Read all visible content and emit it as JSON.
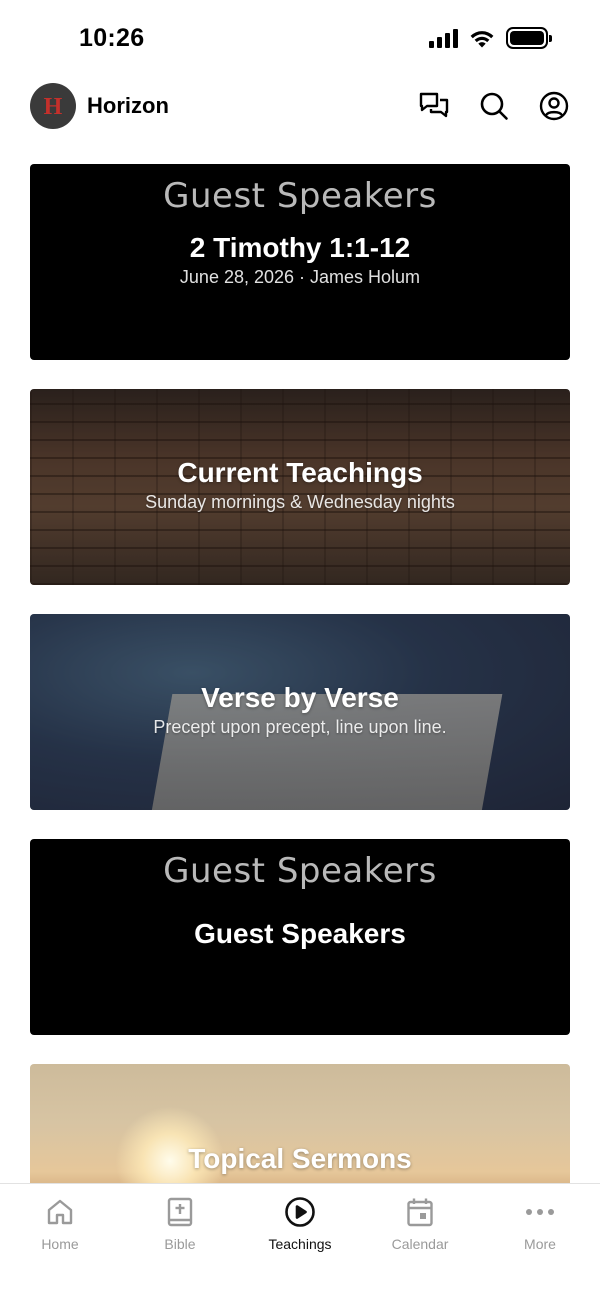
{
  "status_bar": {
    "time": "10:26"
  },
  "header": {
    "app_name": "Horizon",
    "logo_letter": "H",
    "icons": [
      "chat-icon",
      "search-icon",
      "account-icon"
    ]
  },
  "cards": [
    {
      "banner": "Guest Speakers",
      "title": "2 Timothy 1:1-12",
      "subtitle": "June 28, 2026 · James Holum"
    },
    {
      "title": "Current Teachings",
      "subtitle": "Sunday mornings & Wednesday nights"
    },
    {
      "title": "Verse by Verse",
      "subtitle": "Precept upon precept, line upon line."
    },
    {
      "banner": "Guest Speakers",
      "title": "Guest Speakers"
    },
    {
      "title": "Topical Sermons"
    }
  ],
  "tab_bar": {
    "active": "Teachings",
    "tabs": [
      {
        "label": "Home",
        "icon": "home-icon"
      },
      {
        "label": "Bible",
        "icon": "bible-icon"
      },
      {
        "label": "Teachings",
        "icon": "play-circle-icon"
      },
      {
        "label": "Calendar",
        "icon": "calendar-icon"
      },
      {
        "label": "More",
        "icon": "more-icon"
      }
    ]
  },
  "colors": {
    "logo_accent": "#c4302b",
    "tab_inactive": "#9a9a9a",
    "tab_active": "#111111"
  }
}
